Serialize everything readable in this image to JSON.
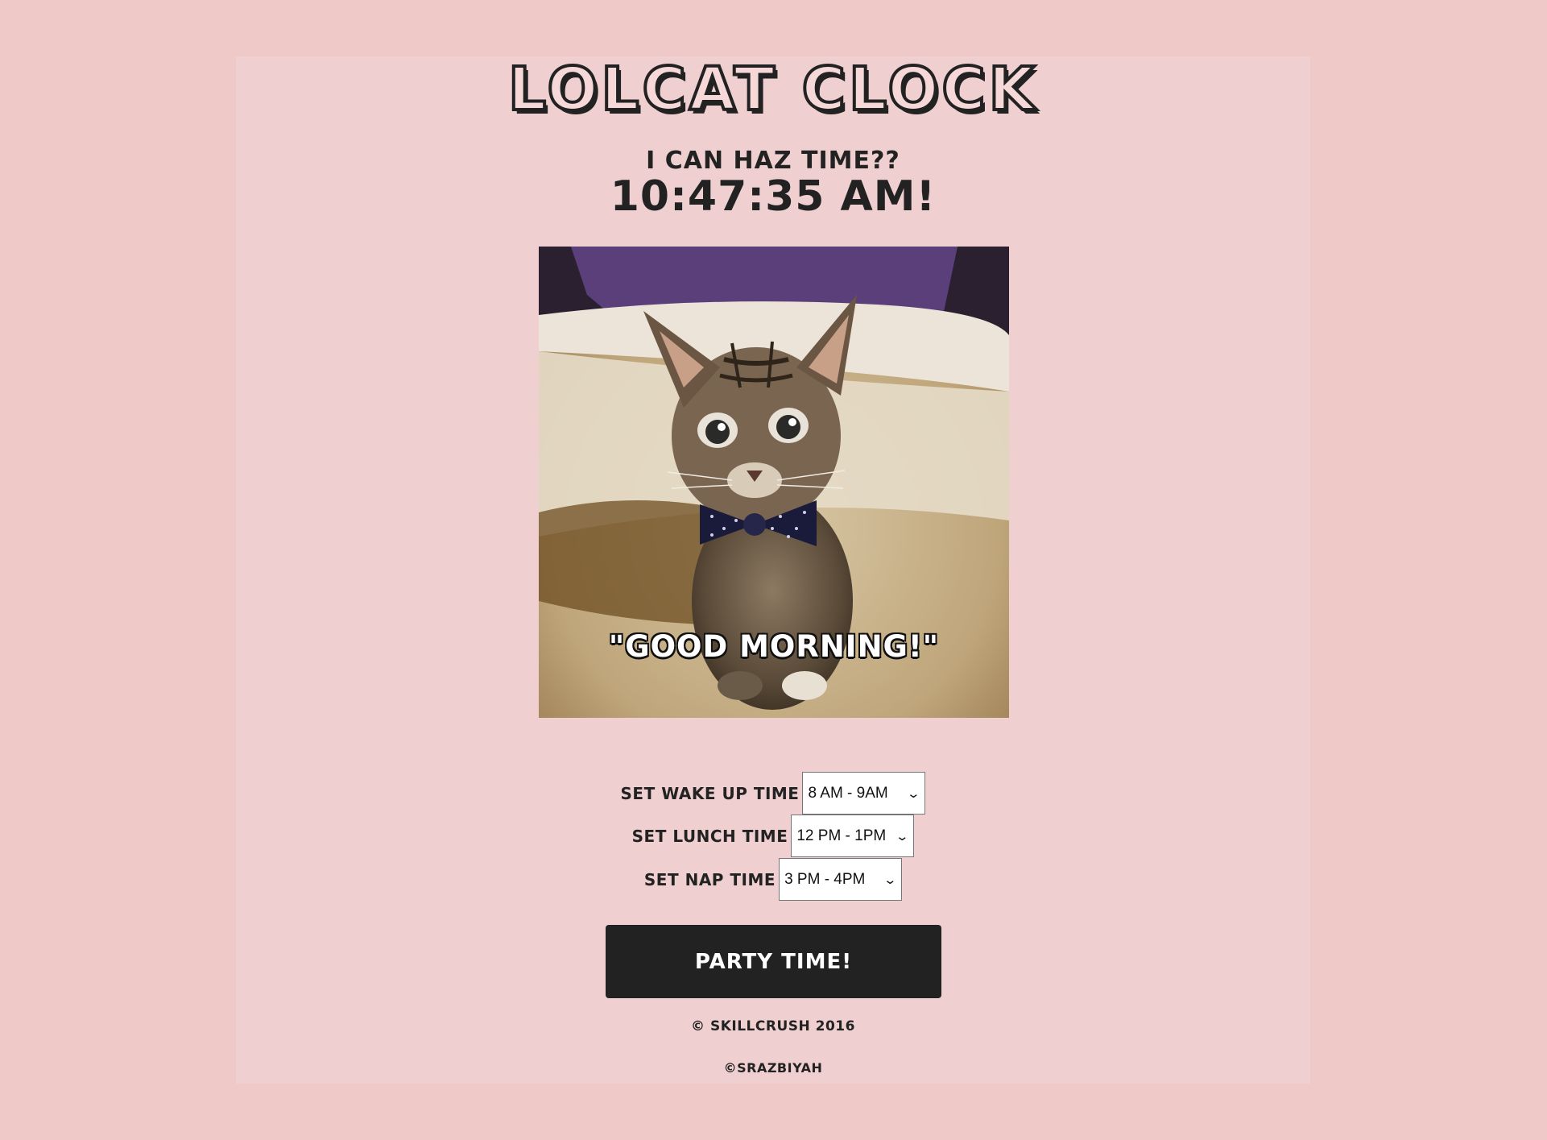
{
  "title": "LOLCAT CLOCK",
  "subtitle": "I CAN HAZ TIME??",
  "clock": "10:47:35 AM!",
  "image": {
    "caption": "\"GOOD MORNING!\""
  },
  "selectors": [
    {
      "label": "SET WAKE UP TIME",
      "value": "8 AM - 9AM"
    },
    {
      "label": "SET LUNCH TIME",
      "value": "12 PM - 1PM"
    },
    {
      "label": "SET NAP TIME",
      "value": "3 PM - 4PM"
    }
  ],
  "party_button": "PARTY TIME!",
  "footer": {
    "copyright": "© SKILLCRUSH 2016",
    "author": "©SRAZBIYAH"
  },
  "colors": {
    "page_background": "#efc8c8",
    "panel_background": "#efcfcf",
    "text": "#222222",
    "button_background": "#222222",
    "button_text": "#ffffff"
  }
}
